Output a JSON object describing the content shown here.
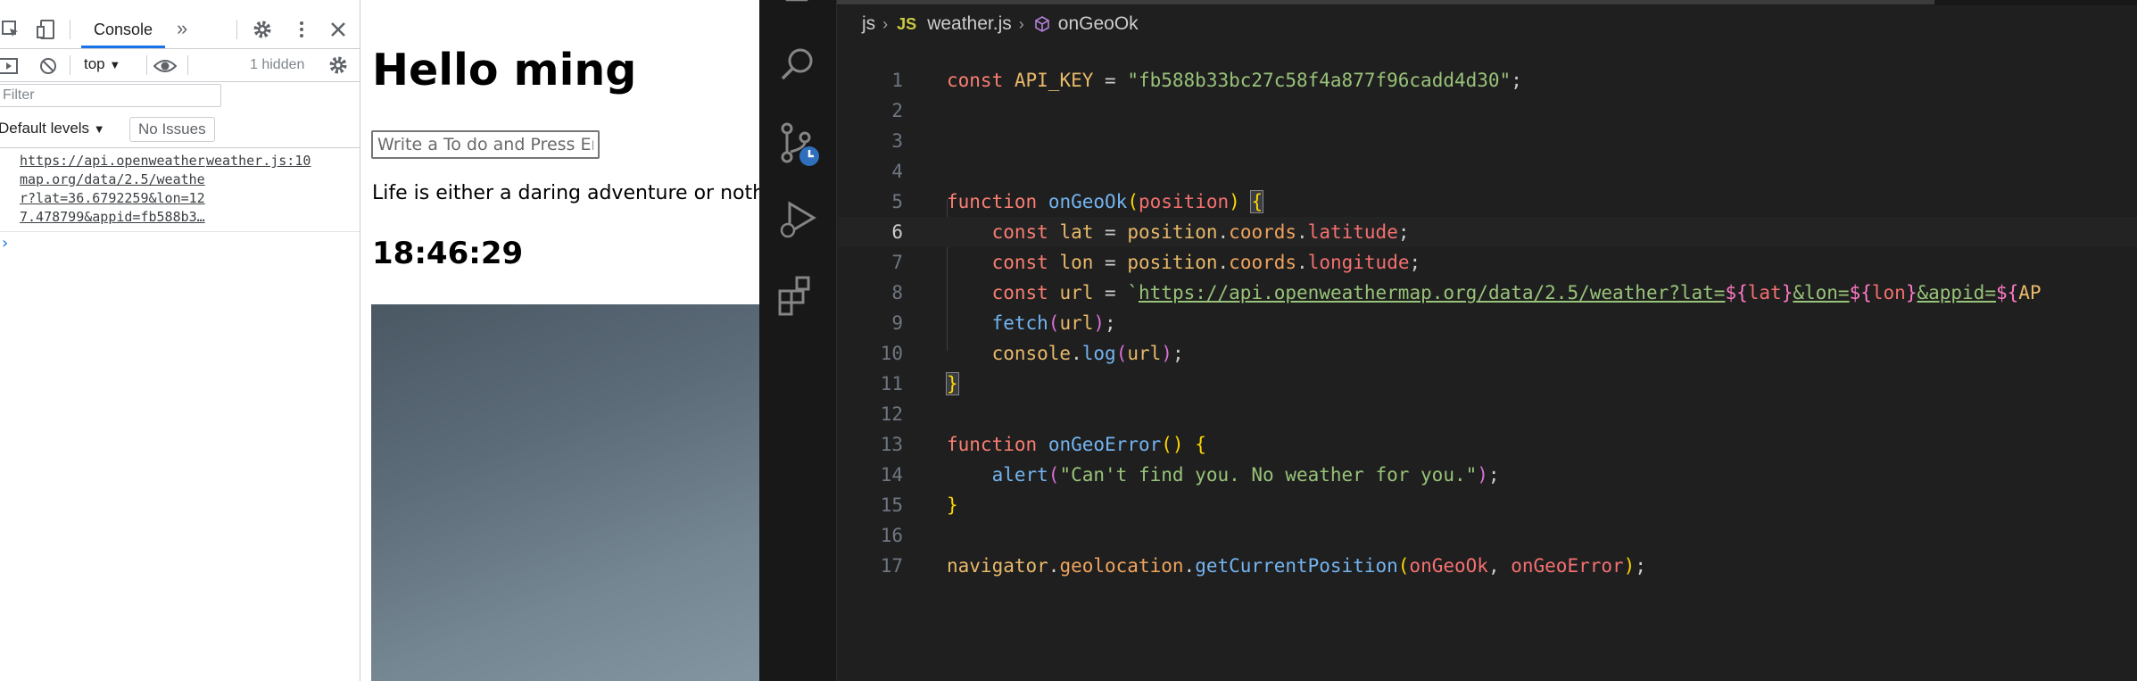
{
  "devtools": {
    "tab_console": "Console",
    "context": "top",
    "hidden_count": "1 hidden",
    "filter_placeholder": "Filter",
    "levels": "Default levels",
    "issues": "No Issues",
    "log_message": "https://api.openweathermap.org/data/2.5/weather?lat=36.6792259&lon=127.478799&appid=fb588b3…",
    "log_source": "weather.js:10",
    "prompt": "›"
  },
  "page": {
    "title": "Hello ming",
    "todo_placeholder": "Write a To do and Press Enter",
    "quote": "Life is either a daring adventure or nothing",
    "clock": "18:46:29"
  },
  "editor": {
    "breadcrumb": {
      "folder": "js",
      "file_badge": "JS",
      "file": "weather.js",
      "symbol": "onGeoOk"
    },
    "active_line": 6,
    "line_numbers": [
      "1",
      "2",
      "3",
      "4",
      "5",
      "6",
      "7",
      "8",
      "9",
      "10",
      "11",
      "12",
      "13",
      "14",
      "15",
      "16",
      "17"
    ],
    "code": {
      "l1_const": "const",
      "l1_name": "API_KEY",
      "l1_eq": " = ",
      "l1_val": "\"fb588b33bc27c58f4a877f96cadd4d30\"",
      "l1_end": ";",
      "l5_kw": "function",
      "l5_fn": "onGeoOk",
      "l5_param": "position",
      "l6_kw": "const",
      "l6_var": "lat",
      "l6_obj": "position",
      "l6_p1": "coords",
      "l6_p2": "latitude",
      "l7_kw": "const",
      "l7_var": "lon",
      "l7_obj": "position",
      "l7_p1": "coords",
      "l7_p2": "longitude",
      "l8_kw": "const",
      "l8_var": "url",
      "l8_url1": "https://api.openweathermap.org/data/2.5/weather?lat=",
      "l8_t1": "${",
      "l8_v1": "lat",
      "l8_t1e": "}",
      "l8_url2": "&lon=",
      "l8_t2": "${",
      "l8_v2": "lon",
      "l8_t2e": "}",
      "l8_url3": "&appid=",
      "l8_t3": "${",
      "l8_v3": "AP",
      "l9_fn": "fetch",
      "l9_arg": "url",
      "l10_obj": "console",
      "l10_fn": "log",
      "l10_arg": "url",
      "l13_kw": "function",
      "l13_fn": "onGeoError",
      "l14_fn": "alert",
      "l14_str": "\"Can't find you. No weather for you.\"",
      "l17_obj": "navigator",
      "l17_prop": "geolocation",
      "l17_fn": "getCurrentPosition",
      "l17_a1": "onGeoOk",
      "l17_a2": "onGeoError"
    }
  }
}
